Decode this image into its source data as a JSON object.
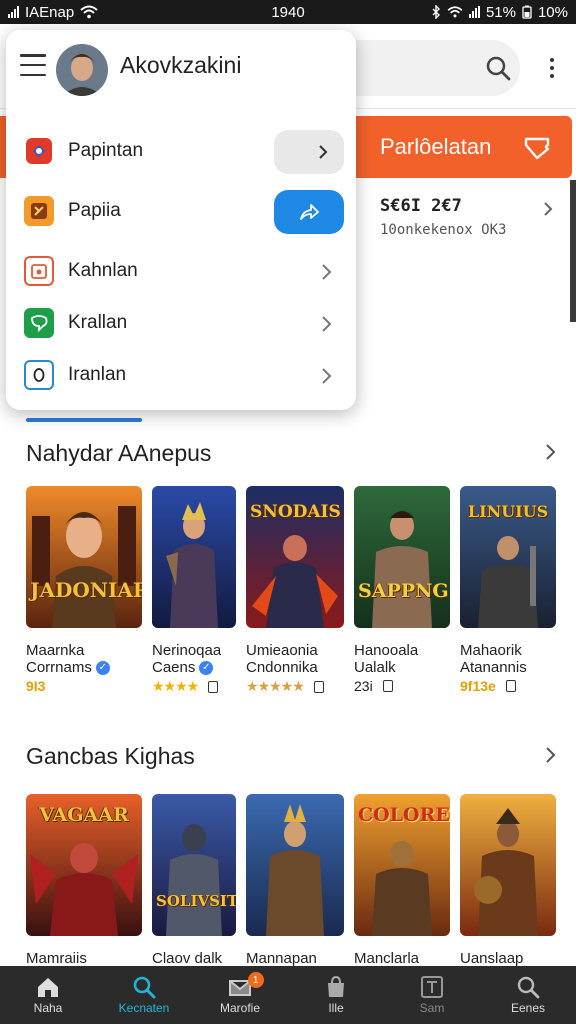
{
  "status_bar": {
    "carrier": "IAEnap",
    "time": "1940",
    "battery_label": "51%",
    "extra_label": "10%"
  },
  "header": {
    "search_icon": "search-icon",
    "more_icon": "more-vert-icon"
  },
  "banner": {
    "label": "Parlôelatan"
  },
  "promo": {
    "title": "S€6I 2€7",
    "subtitle": "10onkekenox OK3"
  },
  "drawer": {
    "title": "Akovkzakini",
    "items": [
      {
        "label": "Papintan",
        "icon": "red-app-icon"
      },
      {
        "label": "Papiia",
        "icon": "puzzle-icon"
      },
      {
        "label": "Kahnlan",
        "icon": "calendar-icon"
      },
      {
        "label": "Krallan",
        "icon": "chat-icon"
      },
      {
        "label": "Iranlan",
        "icon": "zero-doc-icon"
      }
    ]
  },
  "sections": [
    {
      "title": "Nahydar AAnepus",
      "cards": [
        {
          "line1": "Maarnka",
          "line2": "Corrnams",
          "verified": true,
          "meta": "9I3",
          "art": "JADONIAR"
        },
        {
          "line1": "Nerinoqaa",
          "line2": "Caens",
          "verified": true,
          "meta": "★★★★",
          "art": ""
        },
        {
          "line1": "Umieaonia",
          "line2": "Cndonnika",
          "verified": false,
          "meta": "★★★★★",
          "art": "SNODAIS"
        },
        {
          "line1": "Hanooala",
          "line2": "Ualalk",
          "verified": false,
          "meta": "23i",
          "art": "SAPPNG"
        },
        {
          "line1": "Mahaorik",
          "line2": "Atanannis",
          "verified": false,
          "meta": "9f13e",
          "art": "LINUIUS"
        }
      ]
    },
    {
      "title": "Gancbas Kighas",
      "cards": [
        {
          "line1": "Mamraiis",
          "art": "VAGAAR"
        },
        {
          "line1": "Claov dalk",
          "art": "SOLIVSITE"
        },
        {
          "line1": "Mannapan",
          "art": ""
        },
        {
          "line1": "Manclarla",
          "art": "COLORE"
        },
        {
          "line1": "Uanslaap",
          "art": ""
        }
      ]
    }
  ],
  "bottom_nav": [
    {
      "label": "Naha",
      "icon": "home-icon"
    },
    {
      "label": "Kecnaten",
      "icon": "search-icon",
      "active": true
    },
    {
      "label": "Marofie",
      "icon": "inbox-icon",
      "badge": "1"
    },
    {
      "label": "Ille",
      "icon": "bag-icon"
    },
    {
      "label": "Sam",
      "icon": "grid-icon"
    },
    {
      "label": "Eenes",
      "icon": "search-icon"
    }
  ],
  "colors": {
    "accent_orange": "#f2612a",
    "accent_blue": "#2f7ad8",
    "nav_active": "#1fb6d6",
    "nav_bg": "#2b2b2b"
  }
}
